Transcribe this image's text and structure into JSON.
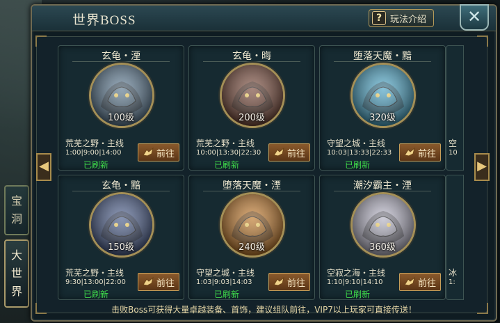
{
  "window": {
    "title": "世界BOSS",
    "help_label": "玩法介绍",
    "close_symbol": "✕"
  },
  "side_tabs": [
    {
      "label": "宝\n洞"
    },
    {
      "label": "大\n世\n界"
    }
  ],
  "nav": {
    "left_arrow": "◀",
    "right_arrow": "▶"
  },
  "bosses": [
    {
      "name": "玄龟・湮",
      "level": "100级",
      "location": "荒芜之野・主线",
      "times": "1:00|9:00|14:00",
      "status": "已刷新",
      "button": "前往",
      "portrait_color": "#5c7a93"
    },
    {
      "name": "玄龟・晦",
      "level": "200级",
      "location": "荒芜之野・主线",
      "times": "10:00|13:30|22:30",
      "status": "已刷新",
      "button": "前往",
      "portrait_color": "#7a4a3a"
    },
    {
      "name": "堕落天魔・黯",
      "level": "320级",
      "location": "守望之城・主线",
      "times": "10:03|13:33|22:33",
      "status": "已刷新",
      "button": "前往",
      "portrait_color": "#4aa7c9"
    },
    {
      "name": "玄龟・黯",
      "level": "150级",
      "location": "荒芜之野・主线",
      "times": "9:30|13:00|22:00",
      "status": "已刷新",
      "button": "前往",
      "portrait_color": "#4a5d8c"
    },
    {
      "name": "堕落天魔・湮",
      "level": "240级",
      "location": "守望之城・主线",
      "times": "1:03|9:03|14:03",
      "status": "已刷新",
      "button": "前往",
      "portrait_color": "#c47a2a"
    },
    {
      "name": "潮汐霸主・湮",
      "level": "360级",
      "location": "空寂之海・主线",
      "times": "1:10|9:10|14:10",
      "status": "已刷新",
      "button": "前往",
      "portrait_color": "#b9b7c9"
    }
  ],
  "partial_cards": [
    {
      "location": "空",
      "times": "10"
    },
    {
      "location": "冰",
      "times": "1:"
    }
  ],
  "footer_text": "击败Boss可获得大量卓越装备、首饰，建议组队前往，VIP7以上玩家可直接传送！"
}
